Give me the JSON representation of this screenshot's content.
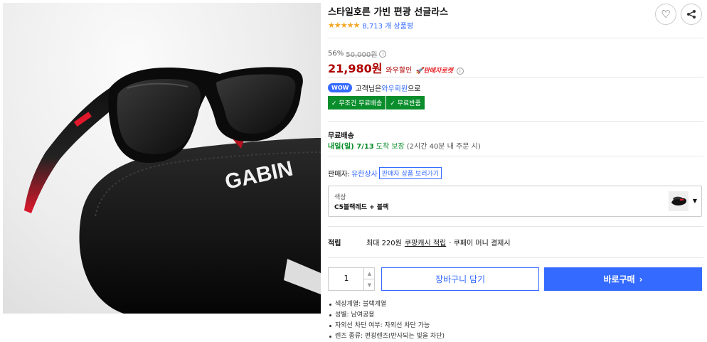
{
  "product": {
    "title": "스타일호른 가빈 편광 선글라스",
    "rating_stars": "★★★★★",
    "review_count": "8,713 개 상품평",
    "case_brand": "GABIN"
  },
  "actions": {
    "heart_icon": "heart-icon",
    "share_icon": "share-icon"
  },
  "pricing": {
    "discount_rate": "56%",
    "original_price": "50,000원",
    "sale_price": "21,980원",
    "wow_discount_label": "와우할인",
    "rocket_badge": "🚀판매자로켓",
    "info_glyph": "i"
  },
  "wow": {
    "badge": "WOW",
    "text_prefix": "고객님은",
    "member_link": "와우회원",
    "text_suffix": "으로"
  },
  "benefits": [
    "✓ 무조건 무료배송",
    "✓ 무료반품"
  ],
  "shipping": {
    "title": "무료배송",
    "arrival": "내일(일) 7/13",
    "guarantee": "도착 보장",
    "condition": "(2시간 40분 내 주문 시)"
  },
  "seller": {
    "label": "판매자:",
    "name": "유한상사",
    "link": "판매자 상품 보러가기"
  },
  "option": {
    "label": "색상",
    "value": "C5블랙레드 + 블랙",
    "caret": "▼"
  },
  "reward": {
    "title": "적립",
    "text": "최대 220원",
    "link": "쿠팡캐시 적립",
    "suffix": "· 쿠페이 머니 결제시"
  },
  "quantity": {
    "value": "1",
    "up": "▲",
    "down": "▼"
  },
  "buttons": {
    "cart": "장바구니 담기",
    "buy": "바로구매",
    "buy_arrow": "›"
  },
  "specs": [
    "색상계열: 블랙계열",
    "성별: 남여공용",
    "자외선 차단 여부: 자외선 차단 가능",
    "렌즈 종류: 편광렌즈(반사되는 빛을 차단)"
  ],
  "colors": {
    "accent_blue": "#346aff",
    "price_red": "#ae0000",
    "benefit_green": "#0a8e2c",
    "star_orange": "#f5a623"
  }
}
